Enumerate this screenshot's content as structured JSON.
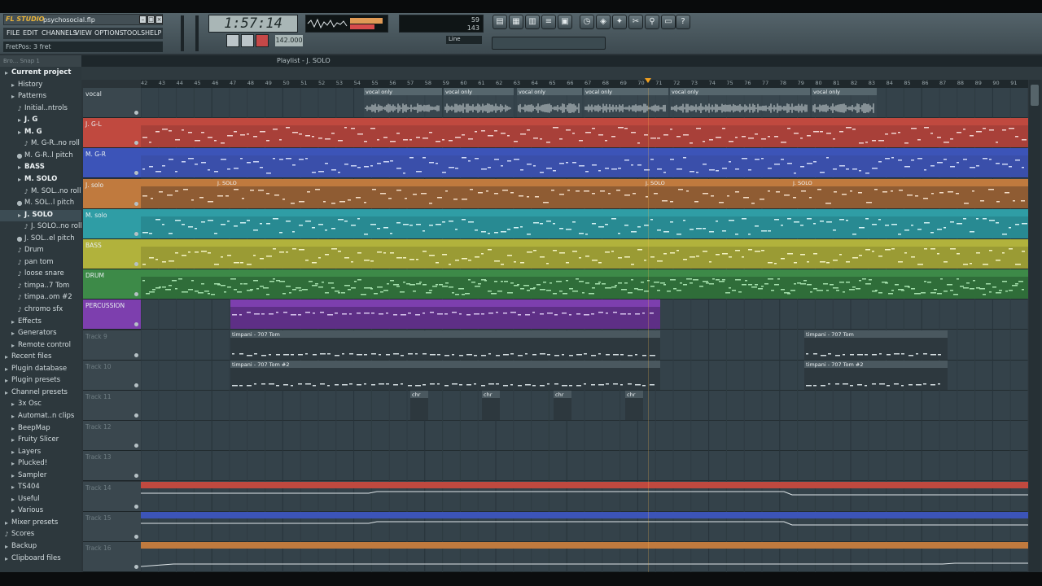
{
  "app": {
    "logo_text": "FL STUDIO",
    "project_file": "psychosocial.flp",
    "menu": [
      "FILE",
      "EDIT",
      "CHANNELS",
      "VIEW",
      "OPTIONS",
      "TOOLS",
      "HELP"
    ],
    "hint_bar": "FretPos: 3 fret",
    "time_display": "1:57:14",
    "tempo_display": "142.000",
    "cpu_value": "59",
    "poly_value": "143",
    "line_select": "Line",
    "colors": {
      "accent": "#e9b43a",
      "playhead": "#f0a020"
    }
  },
  "browser": {
    "header": "Bro... Snap 1",
    "items": [
      {
        "label": "Current project",
        "icon": "folder-icon",
        "indent": 0,
        "bold": true
      },
      {
        "label": "History",
        "icon": "folder-icon",
        "indent": 1
      },
      {
        "label": "Patterns",
        "icon": "folder-icon",
        "indent": 1
      },
      {
        "label": "Initial..ntrols",
        "icon": "note-icon",
        "indent": 2
      },
      {
        "label": "J. G",
        "icon": "folder-icon",
        "indent": 2,
        "bold": true
      },
      {
        "label": "M. G",
        "icon": "folder-icon",
        "indent": 2,
        "bold": true
      },
      {
        "label": "M. G-R..no roll",
        "icon": "note-icon",
        "indent": 3
      },
      {
        "label": "M. G-R..l pitch",
        "icon": "dot-icon",
        "indent": 2
      },
      {
        "label": "BASS",
        "icon": "folder-icon",
        "indent": 2,
        "bold": true
      },
      {
        "label": "M. SOLO",
        "icon": "folder-icon",
        "indent": 2,
        "bold": true
      },
      {
        "label": "M. SOL..no roll",
        "icon": "note-icon",
        "indent": 3
      },
      {
        "label": "M. SOL..l pitch",
        "icon": "dot-icon",
        "indent": 2
      },
      {
        "label": "J. SOLO",
        "icon": "folder-icon",
        "indent": 2,
        "bold": true,
        "selected": true
      },
      {
        "label": "J. SOLO..no roll",
        "icon": "note-icon",
        "indent": 3
      },
      {
        "label": "J. SOL..el pitch",
        "icon": "dot-icon",
        "indent": 2
      },
      {
        "label": "Drum",
        "icon": "note-icon",
        "indent": 2
      },
      {
        "label": "pan tom",
        "icon": "note-icon",
        "indent": 2
      },
      {
        "label": "loose snare",
        "icon": "note-icon",
        "indent": 2
      },
      {
        "label": "timpa..7 Tom",
        "icon": "note-icon",
        "indent": 2
      },
      {
        "label": "timpa..om #2",
        "icon": "note-icon",
        "indent": 2
      },
      {
        "label": "chromo sfx",
        "icon": "note-icon",
        "indent": 2
      },
      {
        "label": "Effects",
        "icon": "folder-icon",
        "indent": 1
      },
      {
        "label": "Generators",
        "icon": "folder-icon",
        "indent": 1
      },
      {
        "label": "Remote control",
        "icon": "folder-icon",
        "indent": 1
      },
      {
        "label": "Recent files",
        "icon": "folder-icon",
        "indent": 0
      },
      {
        "label": "Plugin database",
        "icon": "folder-icon",
        "indent": 0
      },
      {
        "label": "Plugin presets",
        "icon": "folder-icon",
        "indent": 0
      },
      {
        "label": "Channel presets",
        "icon": "folder-icon",
        "indent": 0
      },
      {
        "label": "3x Osc",
        "icon": "folder-icon",
        "indent": 1
      },
      {
        "label": "Automat..n clips",
        "icon": "folder-icon",
        "indent": 1
      },
      {
        "label": "BeepMap",
        "icon": "folder-icon",
        "indent": 1
      },
      {
        "label": "Fruity Slicer",
        "icon": "folder-icon",
        "indent": 1
      },
      {
        "label": "Layers",
        "icon": "folder-icon",
        "indent": 1
      },
      {
        "label": "Plucked!",
        "icon": "folder-icon",
        "indent": 1
      },
      {
        "label": "Sampler",
        "icon": "folder-icon",
        "indent": 1
      },
      {
        "label": "TS404",
        "icon": "folder-icon",
        "indent": 1
      },
      {
        "label": "Useful",
        "icon": "folder-icon",
        "indent": 1
      },
      {
        "label": "Various",
        "icon": "folder-icon",
        "indent": 1
      },
      {
        "label": "Mixer presets",
        "icon": "folder-icon",
        "indent": 0
      },
      {
        "label": "Scores",
        "icon": "note-icon",
        "indent": 0
      },
      {
        "label": "Backup",
        "icon": "folder-icon",
        "indent": 0
      },
      {
        "label": "Clipboard files",
        "icon": "folder-icon",
        "indent": 0
      }
    ]
  },
  "playlist": {
    "title": "Playlist - J. SOLO",
    "ruler_start": 42,
    "ruler_end": 91,
    "playhead_bar": 70,
    "tracks": [
      {
        "name": "vocal",
        "color": "#3b4a51"
      },
      {
        "name": "J. G-L",
        "color": "#c0493f"
      },
      {
        "name": "M. G-R",
        "color": "#3c54b8"
      },
      {
        "name": "J. solo",
        "color": "#c07a3e"
      },
      {
        "name": "M. solo",
        "color": "#2f9da5"
      },
      {
        "name": "BASS",
        "color": "#b1b23c"
      },
      {
        "name": "DRUM",
        "color": "#3d8a48"
      },
      {
        "name": "PERCUSSION",
        "color": "#7d3fae"
      },
      {
        "name": "Track 9",
        "color": "#3b4a51"
      },
      {
        "name": "Track 10",
        "color": "#3b4a51"
      },
      {
        "name": "Track 11",
        "color": "#3b4a51"
      },
      {
        "name": "Track 12",
        "color": "#3b4a51"
      },
      {
        "name": "Track 13",
        "color": "#3b4a51"
      },
      {
        "name": "Track 14",
        "color": "#3b4a51"
      },
      {
        "name": "Track 15",
        "color": "#3b4a51"
      },
      {
        "name": "Track 16",
        "color": "#3b4a51"
      }
    ],
    "clip_labels": {
      "vocal": "vocal only",
      "jsolo": "J. SOLO",
      "timpani1": "timpani - 707 Tom",
      "timpani2": "timpani - 707 Tom #2",
      "chromo": "chr"
    }
  }
}
